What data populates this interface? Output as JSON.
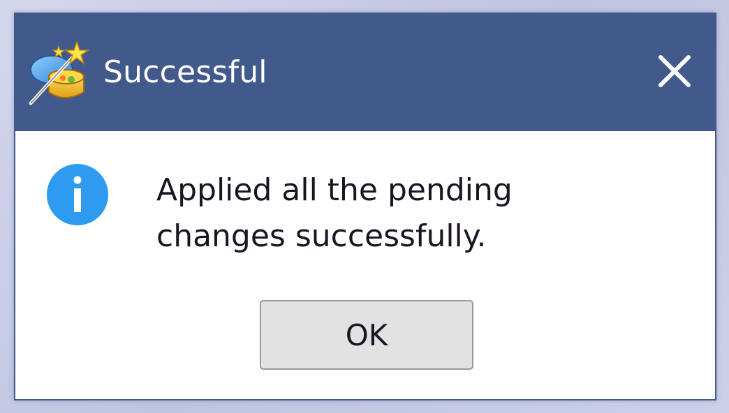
{
  "dialog": {
    "title": "Successful",
    "message_line1": "Applied all the pending",
    "message_line2": "changes successfully.",
    "ok_label": "OK"
  },
  "icons": {
    "app": "app-wand-icon",
    "info": "info-icon",
    "close": "close-icon"
  },
  "colors": {
    "titlebar": "#42598b",
    "info_blue": "#2e9bf0",
    "button_bg": "#e2e2e2"
  }
}
